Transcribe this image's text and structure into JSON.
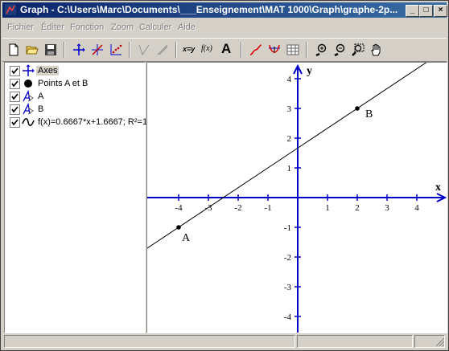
{
  "window": {
    "title": "Graph - C:\\Users\\Marc\\Documents\\___Enseignement\\MAT 1000\\Graph\\graphe-2p...",
    "min_label": "_",
    "max_label": "□",
    "close_label": "×"
  },
  "menu": [
    "Fichier",
    "Éditer",
    "Fonction",
    "Zoom",
    "Calculer",
    "Aide"
  ],
  "toolbar": {
    "icons": [
      "new-file-icon",
      "open-folder-icon",
      "save-icon",
      "axes-icon",
      "intersection-icon",
      "point-series-icon",
      "tangent-icon",
      "relation-icon",
      "xy-label",
      "fx-label",
      "text-label",
      "function-curve-icon",
      "evaluate-icon",
      "table-icon",
      "zoom-in-icon",
      "zoom-out-icon",
      "zoom-window-icon",
      "move-hand-icon"
    ],
    "xy_text": "x=y",
    "fx_text": "f(x)",
    "text_tool": "A"
  },
  "tree": {
    "items": [
      {
        "label": "Axes",
        "checked": true,
        "icon": "axes-icon",
        "selected": true
      },
      {
        "label": "Points A et B",
        "checked": true,
        "icon": "point-dot-icon",
        "selected": false
      },
      {
        "label": "A",
        "checked": true,
        "icon": "label-icon",
        "selected": false
      },
      {
        "label": "B",
        "checked": true,
        "icon": "label-icon",
        "selected": false
      },
      {
        "label": "f(x)=0.6667*x+1.6667; R²=1",
        "checked": true,
        "icon": "curve-icon",
        "selected": false
      }
    ]
  },
  "graph": {
    "x_axis_label": "x",
    "y_axis_label": "y",
    "x_ticks": [
      "-4",
      "-3",
      "-2",
      "-1",
      "1",
      "2",
      "3",
      "4"
    ],
    "y_ticks": [
      "4",
      "3",
      "2",
      "1",
      "-1",
      "-2",
      "-3",
      "-4"
    ],
    "points": [
      {
        "name": "A",
        "x": -4,
        "y": -1
      },
      {
        "name": "B",
        "x": 2,
        "y": 3
      }
    ],
    "line": {
      "slope": 0.6667,
      "intercept": 1.6667
    },
    "axis_color": "#0000c8"
  }
}
